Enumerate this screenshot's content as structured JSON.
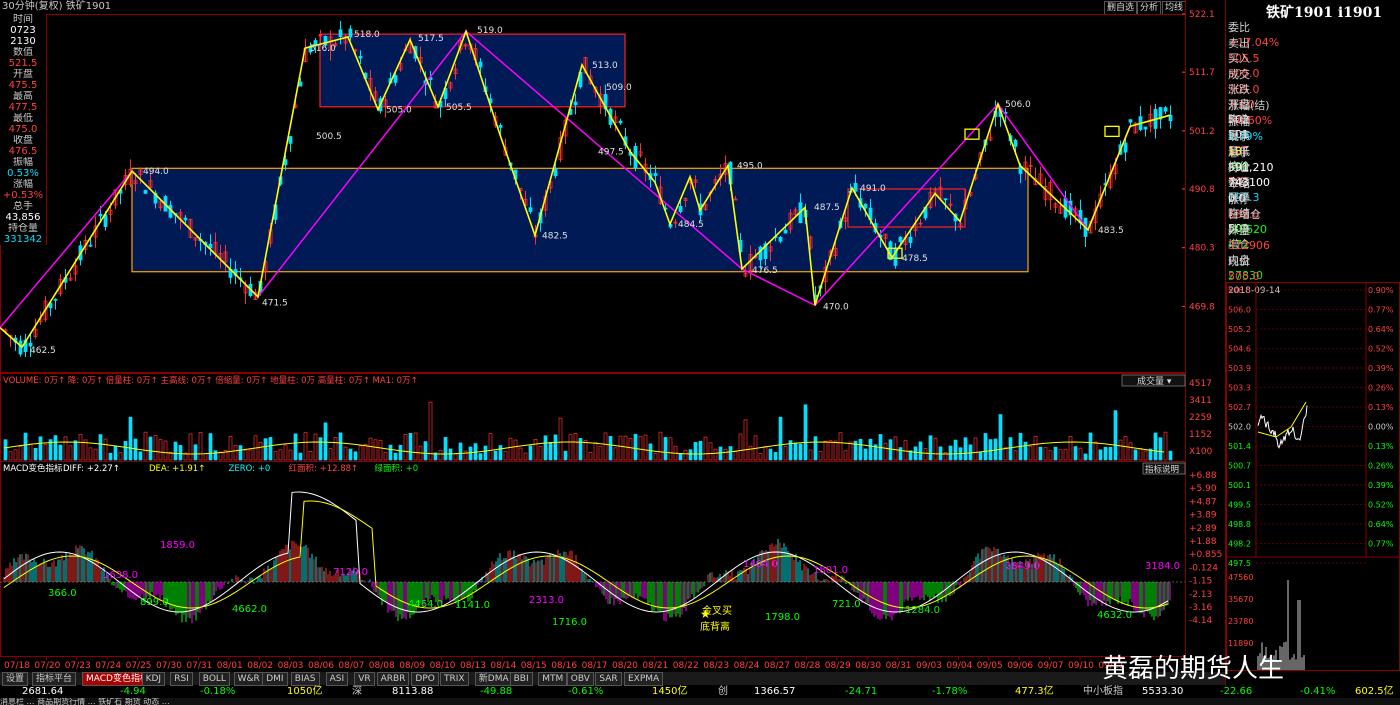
{
  "topbar": {
    "title": "30分钟(复权)",
    "symbol": "铁矿1901",
    "btn1": "删自选",
    "btn2": "分析",
    "btn3": "均线"
  },
  "infobox": [
    {
      "label": "时间",
      "value": "0723",
      "value2": "2130",
      "vc": "v-white"
    },
    {
      "label": "数值",
      "value": "521.5",
      "vc": "v-red"
    },
    {
      "label": "开盘",
      "value": "475.5",
      "vc": "v-red"
    },
    {
      "label": "最高",
      "value": "477.5",
      "vc": "v-red"
    },
    {
      "label": "最低",
      "value": "475.0",
      "vc": "v-red"
    },
    {
      "label": "收盘",
      "value": "476.5",
      "vc": "v-red"
    },
    {
      "label": "振幅",
      "value": "0.53%",
      "vc": "v-cyan"
    },
    {
      "label": "涨幅",
      "value": "+0.53%",
      "vc": "v-red"
    },
    {
      "label": "总手",
      "value": "43,856",
      "vc": "v-white"
    },
    {
      "label": "持仓量",
      "value": "331342",
      "vc": "v-cyan"
    }
  ],
  "price_axis": [
    "522.1",
    "511.7",
    "501.2",
    "490.8",
    "480.3",
    "469.8"
  ],
  "volume_axis": [
    "4517",
    "3411",
    "2259",
    "1152",
    "X100"
  ],
  "macd_axis": [
    "+6.88",
    "+5.90",
    "+4.87",
    "+3.89",
    "+2.89",
    "+1.88",
    "+0.855",
    "-0.124",
    "-1.15",
    "-2.13",
    "-3.16",
    "-4.14"
  ],
  "volume_legend": {
    "text": "VOLUME: 0万↑ 降: 0万↑ 倍量柱: 0万↑ 主高线: 0万↑ 倍缩量: 0万↑ 地量柱: 0万 高量柱: 0万↑ MA1: 0万↑",
    "btn": "成交量"
  },
  "macd_legend": {
    "name": "MACD变色指标",
    "diff": "DIFF: +2.27↑",
    "dea": "DEA: +1.91↑",
    "zero": "ZERO: +0",
    "red": "红面积: +12.88↑",
    "green": "绿面积: +0",
    "btn": "指标说明"
  },
  "price_labels": [
    {
      "t": "494.0"
    },
    {
      "t": "471.5"
    },
    {
      "t": "462.5"
    },
    {
      "t": "516.0"
    },
    {
      "t": "518.0"
    },
    {
      "t": "517.5"
    },
    {
      "t": "519.0"
    },
    {
      "t": "500.5"
    },
    {
      "t": "505.0"
    },
    {
      "t": "505.5"
    },
    {
      "t": "513.0"
    },
    {
      "t": "509.0"
    },
    {
      "t": "497.5"
    },
    {
      "t": "482.5"
    },
    {
      "t": "495.0"
    },
    {
      "t": "484.5"
    },
    {
      "t": "476.5"
    },
    {
      "t": "470.0"
    },
    {
      "t": "487.5"
    },
    {
      "t": "491.0"
    },
    {
      "t": "478.5"
    },
    {
      "t": "506.0"
    },
    {
      "t": "483.5"
    }
  ],
  "macd_labels": [
    {
      "t": "1859.0"
    },
    {
      "t": "1638.0"
    },
    {
      "t": "366.0"
    },
    {
      "t": "899.0"
    },
    {
      "t": "4662.0"
    },
    {
      "t": "7120.0"
    },
    {
      "t": "4464.0"
    },
    {
      "t": "1141.0"
    },
    {
      "t": "2313.0"
    },
    {
      "t": "1716.0"
    },
    {
      "t": "1404.0"
    },
    {
      "t": "1801.0"
    },
    {
      "t": "1798.0"
    },
    {
      "t": "721.0"
    },
    {
      "t": "1284.0"
    },
    {
      "t": "2849.0"
    },
    {
      "t": "3184.0"
    },
    {
      "t": "4632.0"
    },
    {
      "t": "金叉买"
    },
    {
      "t": "底背离"
    }
  ],
  "dates": [
    "07/18",
    "07/20",
    "07/23",
    "07/24",
    "07/25",
    "07/30",
    "07/31",
    "08/01",
    "08/02",
    "08/03",
    "08/06",
    "08/07",
    "08/08",
    "08/09",
    "08/10",
    "08/13",
    "08/14",
    "08/15",
    "08/16",
    "08/17",
    "08/20",
    "08/21",
    "08/22",
    "08/23",
    "08/24",
    "08/27",
    "08/28",
    "08/29",
    "08/30",
    "08/31",
    "09/03",
    "09/04",
    "09/05",
    "09/06",
    "09/07",
    "09/10",
    "09/11"
  ],
  "tabs": [
    "设置",
    "指标平台",
    "MACD变色指标",
    "KDJ",
    "RSI",
    "BOLL",
    "W&R",
    "DMI",
    "BIAS",
    "ASI",
    "VR",
    "ARBR",
    "DPO",
    "TRIX",
    "新DMA",
    "BBI",
    "MTM",
    "OBV",
    "SAR",
    "EXPMA"
  ],
  "index_bar": [
    {
      "t": "2681.64",
      "c": "#fff"
    },
    {
      "t": "-4.94",
      "c": "#00ff00"
    },
    {
      "t": "-0.18%",
      "c": "#00ff00"
    },
    {
      "t": "1050亿",
      "c": "#ffff00"
    },
    {
      "t": "深",
      "c": "#ccc"
    },
    {
      "t": "8113.88",
      "c": "#fff"
    },
    {
      "t": "-49.88",
      "c": "#00ff00"
    },
    {
      "t": "-0.61%",
      "c": "#00ff00"
    },
    {
      "t": "1450亿",
      "c": "#ffff00"
    },
    {
      "t": "创",
      "c": "#ccc"
    },
    {
      "t": "1366.57",
      "c": "#fff"
    },
    {
      "t": "-24.71",
      "c": "#00ff00"
    },
    {
      "t": "-1.78%",
      "c": "#00ff00"
    },
    {
      "t": "477.3亿",
      "c": "#ffff00"
    },
    {
      "t": "中小板指",
      "c": "#ccc"
    },
    {
      "t": "5533.30",
      "c": "#fff"
    },
    {
      "t": "-22.66",
      "c": "#00ff00"
    },
    {
      "t": "-0.41%",
      "c": "#00ff00"
    },
    {
      "t": "602.5亿",
      "c": "#ffff00"
    }
  ],
  "ticker": "消息栏 … 商品期货行情 … 铁矿石 期货 动态 …",
  "watermark": "黄磊的期货人生",
  "right_panel": {
    "title": "铁矿1901 i1901",
    "rows": [
      {
        "l": "委比",
        "v": "+17.04%",
        "vc": "#ff4040",
        "l2": "",
        "v2": "",
        "v2c": "#ccc"
      },
      {
        "l": "卖出",
        "v": "505.5",
        "vc": "#ff4040",
        "l2": "",
        "v2": "",
        "v2c": "#ccc"
      },
      {
        "l": "买入",
        "v": "505.0",
        "vc": "#ff4040",
        "l2": "",
        "v2": "",
        "v2c": "#ccc"
      },
      {
        "l": "成交",
        "v": "505.0",
        "vc": "#ff4040",
        "l2": "开盘",
        "v2": "502",
        "v2c": "#fff"
      },
      {
        "l": "涨跌",
        "v": "+3.0",
        "vc": "#ff4040",
        "l2": "昨收",
        "v2": "501",
        "v2c": "#fff"
      },
      {
        "l": "涨幅(结)",
        "v": "+0.60%",
        "vc": "#ff4040",
        "l2": "最高",
        "v2": "507",
        "v2c": "#ff4040"
      },
      {
        "l": "振幅",
        "v": "1.79%",
        "vc": "#00e0ff",
        "l2": "最低",
        "v2": "498",
        "v2c": "#00ff00"
      },
      {
        "l": "现手",
        "v": "18",
        "vc": "#ffff00",
        "l2": "均价",
        "v2": "502",
        "v2c": "#ff4040"
      },
      {
        "l": "总手",
        "v": "591,210",
        "vc": "#fff",
        "l2": "金额",
        "v2": "297.3",
        "v2c": "#00e0ff"
      },
      {
        "l": "持仓",
        "v": "743100",
        "vc": "#fff",
        "l2": "开平",
        "v2": "",
        "v2c": "#ccc"
      },
      {
        "l": "今结",
        "v": "0.0",
        "vc": "#fff",
        "l2": "昨结",
        "v2": "502",
        "v2c": "#fff"
      },
      {
        "l": "涨停",
        "v": "532.0",
        "vc": "#ff4040",
        "l2": "跌停",
        "v2": "472",
        "v2c": "#00ff00"
      },
      {
        "l": "日增仓",
        "v": "-30620",
        "vc": "#00ff00",
        "l2": "增仓",
        "v2": "-",
        "v2c": "#ccc"
      },
      {
        "l": "外盘",
        "v": "312906",
        "vc": "#ff4040",
        "l2": "内盘",
        "v2": "27830",
        "v2c": "#00ff00"
      }
    ],
    "now_label": "现价",
    "now_value": "505.0",
    "now_date": "2018-09-14",
    "mini_left_axis": [
      "506.5",
      "506.0",
      "505.2",
      "504.6",
      "503.9",
      "503.3",
      "502.7",
      "502.0",
      "501.4",
      "500.7",
      "500.1",
      "499.5",
      "498.8",
      "498.2",
      "497.5"
    ],
    "mini_right_axis": [
      "0.90%",
      "0.77%",
      "0.64%",
      "0.52%",
      "0.39%",
      "0.26%",
      "0.13%",
      "0.00%",
      "0.13%",
      "0.26%",
      "0.39%",
      "0.52%",
      "0.64%",
      "0.77%"
    ],
    "mini_vol_axis": [
      "47560",
      "35670",
      "23780",
      "11890"
    ]
  },
  "colors": {
    "up": "#ff3030",
    "down": "#00e0ff",
    "yellow": "#ffff00",
    "magenta": "#ff00ff",
    "navy": "#001a55",
    "orange": "#ffa500",
    "red_box": "#ff2020",
    "macd_green": "#00ff00"
  }
}
